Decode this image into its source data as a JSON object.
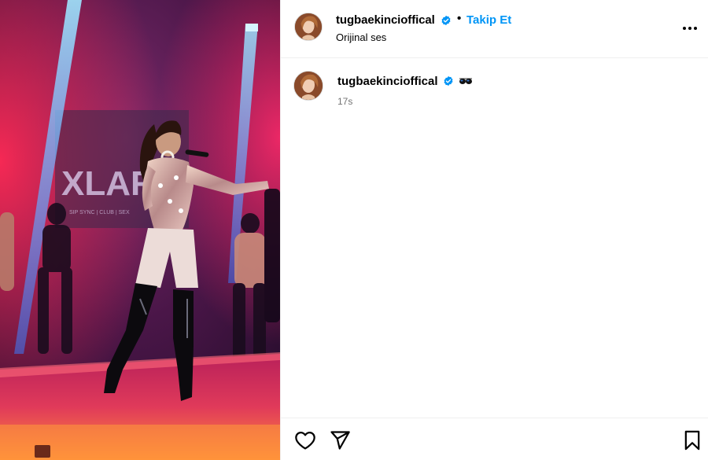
{
  "post": {
    "username": "tugbaekincioffical",
    "follow_label": "Takip Et",
    "separator": "•",
    "audio_label": "Orijinal ses",
    "more_icon": "more-horizontal-icon",
    "verified_color": "#0095f6"
  },
  "caption": {
    "username": "tugbaekincioffical",
    "emoji": "sunglasses-emoji",
    "timestamp": "17s"
  },
  "media": {
    "stage_sign_text": "XLARG",
    "stage_sign_subtext": "SIP SYNC | CLUB | SEX"
  },
  "actions": {
    "like_icon": "heart-icon",
    "share_icon": "paper-plane-icon",
    "save_icon": "bookmark-icon"
  },
  "colors": {
    "accent": "#0095f6",
    "muted_text": "#737373",
    "divider": "#efefef"
  }
}
